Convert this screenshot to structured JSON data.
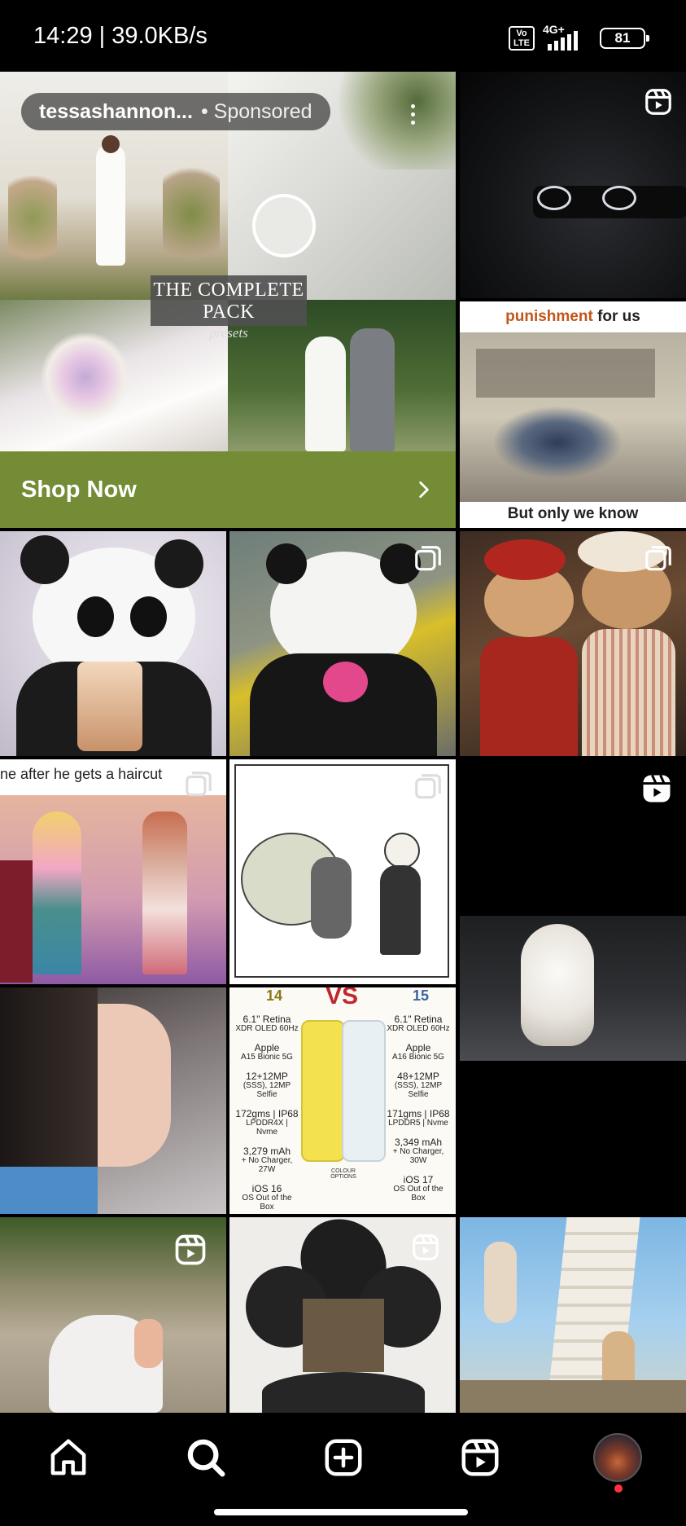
{
  "status_bar": {
    "time_speed": "14:29 | 39.0KB/s",
    "volte": "Vo LTE",
    "network": "4G+",
    "battery": "81"
  },
  "ad": {
    "username": "tessashannon...",
    "sponsored": "• Sponsored",
    "caption_title": "THE COMPLETE PACK",
    "caption_sub": "presets",
    "cta_label": "Shop Now",
    "cta_color": "#738c35"
  },
  "tiles": {
    "punishment_top_accent": "punishment",
    "punishment_top_rest": " for us",
    "punishment_bottom": "But only we know",
    "haircut_caption": "ne after he gets a haircut",
    "phone_compare": {
      "left_model": "14",
      "vs": "VS",
      "right_model": "15",
      "left_specs": [
        "6.1\" Retina",
        "XDR OLED 60Hz",
        "Apple",
        "A15 Bionic 5G",
        "12+12MP",
        "(SSS), 12MP Selfie",
        "172gms | IP68",
        "LPDDR4X | Nvme",
        "3,279 mAh",
        "+ No Charger, 27W",
        "iOS 16",
        "OS Out of the Box"
      ],
      "right_specs": [
        "6.1\" Retina",
        "XDR OLED 60Hz",
        "Apple",
        "A16 Bionic 5G",
        "48+12MP",
        "(SSS), 12MP Selfie",
        "171gms | IP68",
        "LPDDR5 | Nvme",
        "3,349 mAh",
        "+ No Charger, 30W",
        "iOS 17",
        "OS Out of the Box"
      ],
      "center_label": "COLOUR OPTIONS"
    }
  },
  "nav": {
    "home": "home-icon",
    "search": "search-icon",
    "create": "create-icon",
    "reels": "reels-icon",
    "profile": "profile-avatar"
  }
}
